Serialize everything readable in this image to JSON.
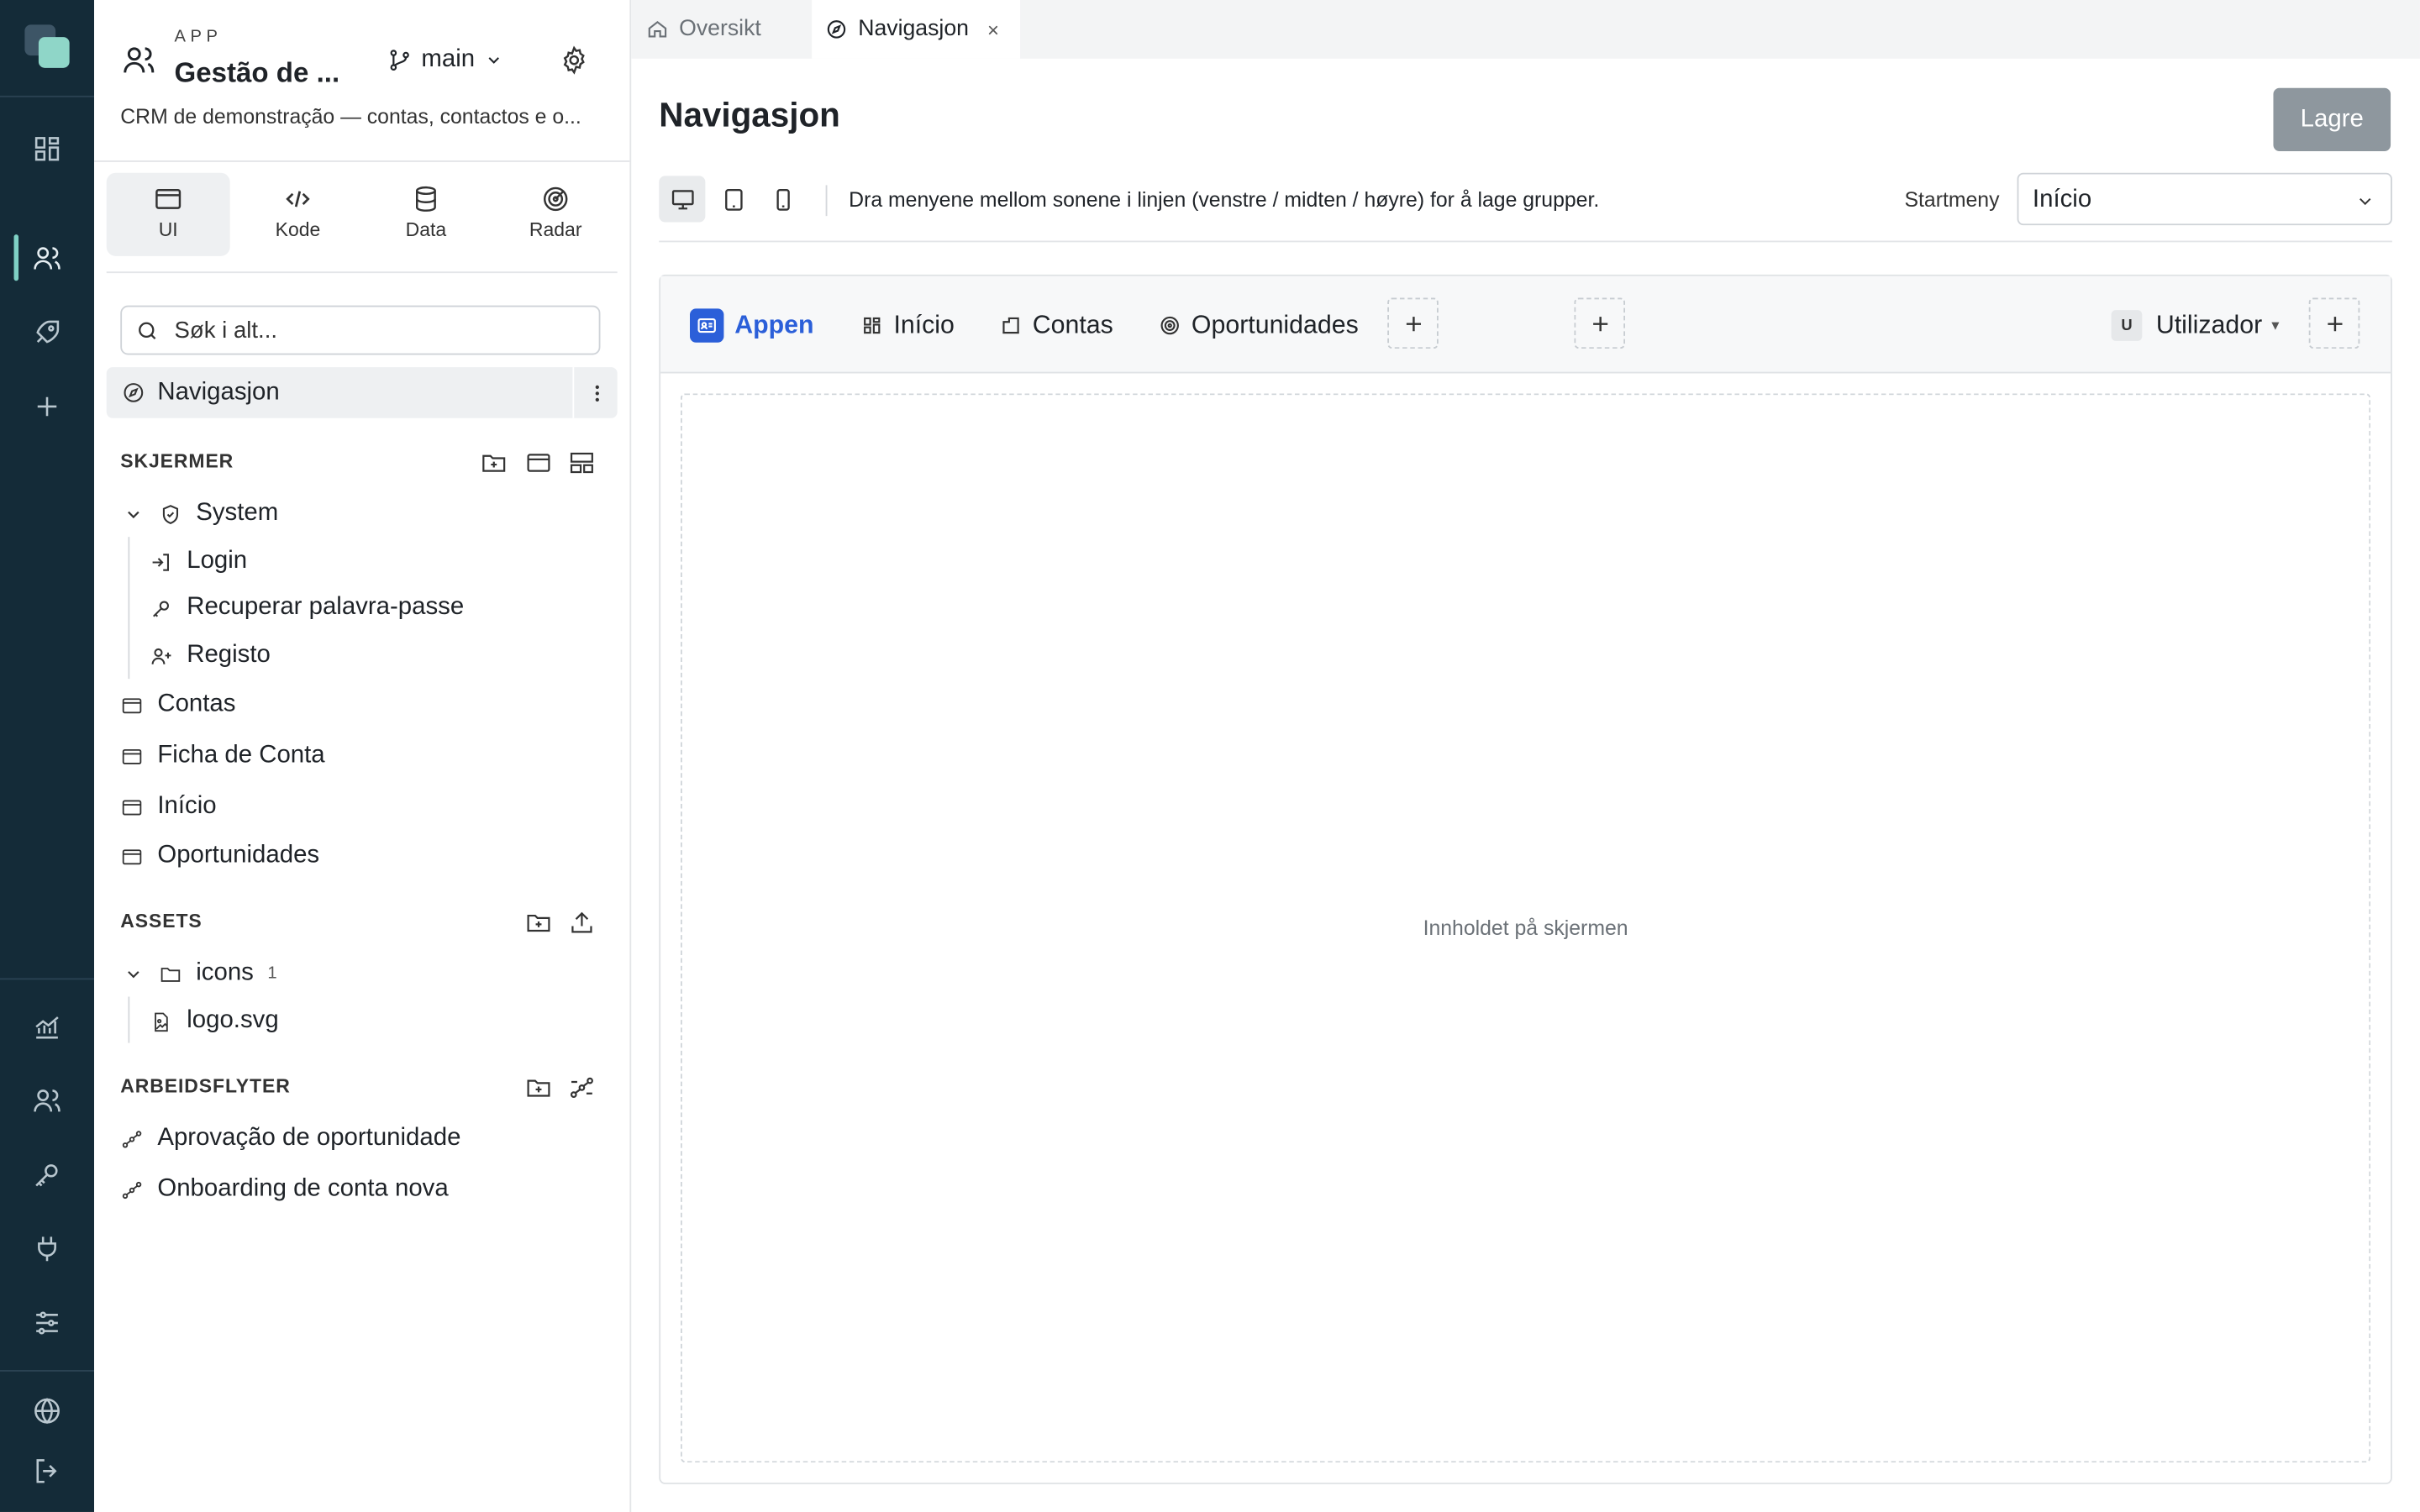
{
  "app": {
    "kicker": "APP",
    "name": "Gestão de ...",
    "branch": "main",
    "description": "CRM de demonstração — contas, contactos e o..."
  },
  "modes": [
    {
      "label": "UI",
      "icon": "window-icon",
      "active": true
    },
    {
      "label": "Kode",
      "icon": "code-icon"
    },
    {
      "label": "Data",
      "icon": "database-icon"
    },
    {
      "label": "Radar",
      "icon": "radar-icon"
    }
  ],
  "search": {
    "placeholder": "Søk i alt..."
  },
  "navigation_item": {
    "label": "Navigasjon"
  },
  "sections": {
    "screens": {
      "title": "SKJERMER",
      "folder": "System",
      "system_children": [
        "Login",
        "Recuperar palavra-passe",
        "Registo"
      ],
      "items": [
        "Contas",
        "Ficha de Conta",
        "Início",
        "Oportunidades"
      ]
    },
    "assets": {
      "title": "ASSETS",
      "folder": "icons",
      "folder_count": "1",
      "files": [
        "logo.svg"
      ]
    },
    "workflows": {
      "title": "ARBEIDSFLYTER",
      "items": [
        "Aprovação de oportunidade",
        "Onboarding de conta nova"
      ]
    }
  },
  "tabs": [
    {
      "label": "Oversikt",
      "icon": "home-icon",
      "active": false
    },
    {
      "label": "Navigasjon",
      "icon": "compass-icon",
      "active": true,
      "close": "×"
    }
  ],
  "page": {
    "title": "Navigasjon",
    "save_label": "Lagre"
  },
  "toolbar": {
    "devices": [
      "desktop-icon",
      "tablet-icon",
      "phone-icon"
    ],
    "hint": "Dra menyene mellom sonene i linjen (venstre / midten / høyre) for å lage grupper.",
    "start_menu_label": "Startmeny",
    "start_menu_value": "Início"
  },
  "preview": {
    "brand": "Appen",
    "menu_items": [
      {
        "label": "Início",
        "icon": "grid-icon"
      },
      {
        "label": "Contas",
        "icon": "building-icon"
      },
      {
        "label": "Oportunidades",
        "icon": "target-icon"
      }
    ],
    "user_initial": "U",
    "user_label": "Utilizador",
    "content_placeholder": "Innholdet på skjermen"
  },
  "colors": {
    "rail_bg": "#142b38",
    "accent": "#7fd1c5",
    "brand_blue": "#2b5fd9",
    "save_button": "#8e979e"
  }
}
